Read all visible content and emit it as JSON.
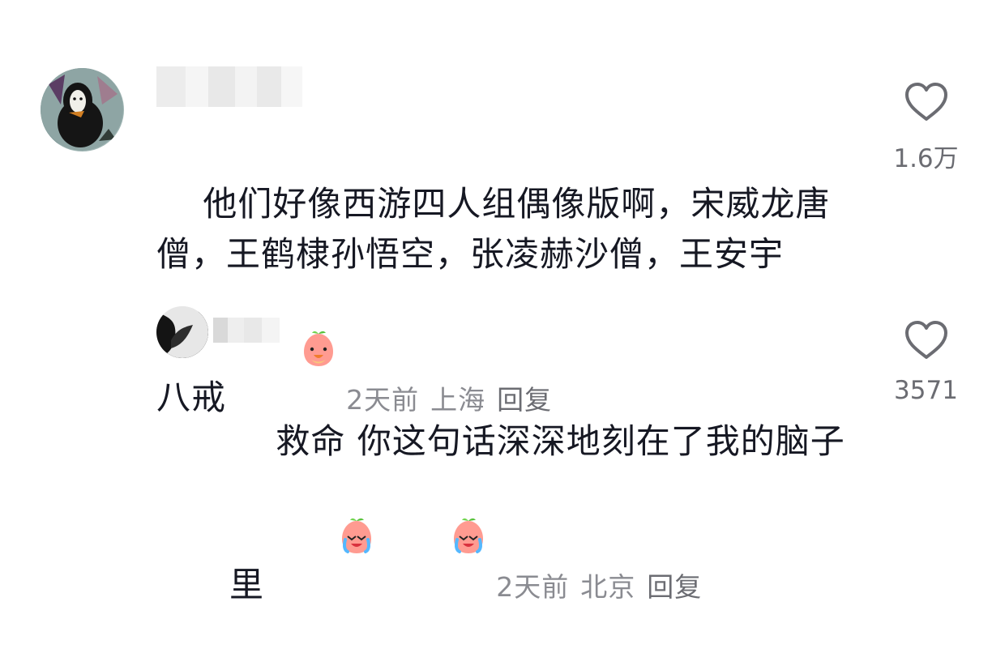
{
  "comments": [
    {
      "text": "他们好像西游四人组偶像版啊，宋威龙唐\n僧，王鹤棣孙悟空，张凌赫沙僧，王安宇\n八戒",
      "emoji": "peach-face-emoji",
      "time": "2天前",
      "location": "上海",
      "reply_label": "回复",
      "like_count": "1.6万",
      "like_icon": "heart-outline-icon"
    },
    {
      "text": "救命 你这句话深深地刻在了我的脑子\n里",
      "emoji": "crying-peach-emoji",
      "time": "2天前",
      "location": "北京",
      "reply_label": "回复",
      "like_count": "3571",
      "like_icon": "heart-outline-icon"
    }
  ],
  "colors": {
    "text": "#161823",
    "meta": "#8a8b91",
    "icon": "#6b6c72"
  }
}
